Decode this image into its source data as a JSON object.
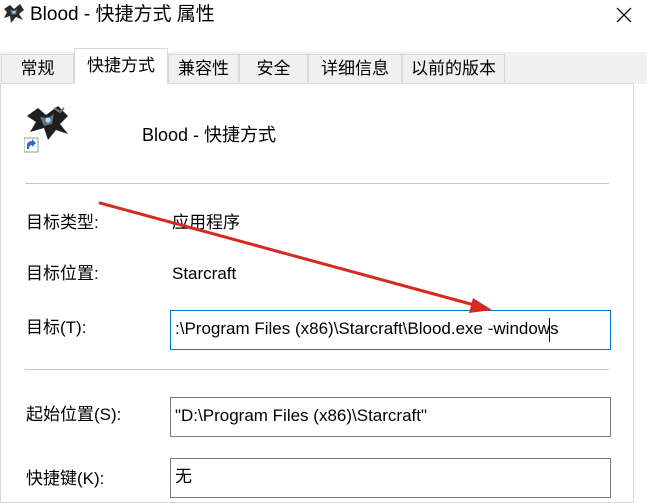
{
  "window": {
    "title": "Blood - 快捷方式 属性",
    "close_glyph": "✕"
  },
  "tabs": [
    {
      "label": "常规",
      "active": false
    },
    {
      "label": "快捷方式",
      "active": true
    },
    {
      "label": "兼容性",
      "active": false
    },
    {
      "label": "安全",
      "active": false
    },
    {
      "label": "详细信息",
      "active": false
    },
    {
      "label": "以前的版本",
      "active": false
    }
  ],
  "shortcut": {
    "name": "Blood - 快捷方式",
    "icon": "starcraft-app-icon"
  },
  "fields": {
    "target_type": {
      "label": "目标类型:",
      "value": "应用程序"
    },
    "target_location": {
      "label": "目标位置:",
      "value": "Starcraft"
    },
    "target": {
      "label": "目标(T):",
      "value": ":\\Program Files (x86)\\Starcraft\\Blood.exe -windows"
    },
    "start_in": {
      "label": "起始位置(S):",
      "value": "\"D:\\Program Files (x86)\\Starcraft\""
    },
    "hotkey": {
      "label": "快捷键(K):",
      "value": "无"
    }
  },
  "annotation": {
    "color": "#d42a22"
  },
  "colors": {
    "focus_border": "#0078d7",
    "tab_bg": "#f0f0f0"
  }
}
